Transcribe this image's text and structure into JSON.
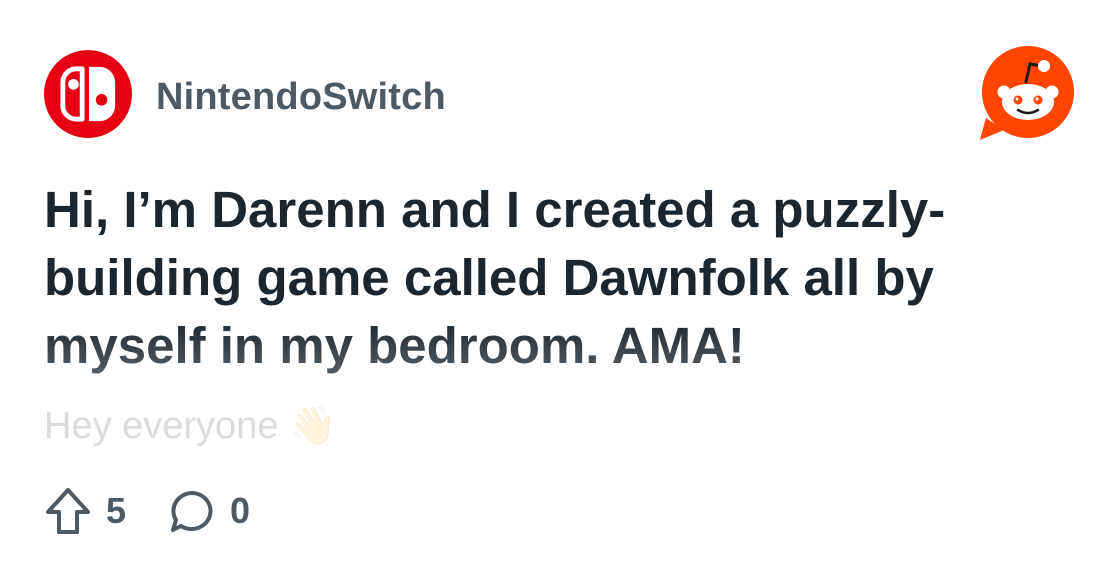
{
  "community": {
    "name": "NintendoSwitch",
    "avatar_icon": "nintendo-switch-logo",
    "brand_color": "#e60012"
  },
  "brand": {
    "logo_icon": "reddit-snoo-logo",
    "color": "#ff4500"
  },
  "post": {
    "title": "Hi, I’m Darenn and I created a puzzly-building game called Dawnfolk all by myself in my bedroom. AMA!",
    "body_preview": "Hey everyone",
    "body_emoji": "👋",
    "upvotes": "5",
    "comments": "0",
    "upvote_icon": "upvote-arrow-icon",
    "comment_icon": "comment-bubble-icon"
  }
}
